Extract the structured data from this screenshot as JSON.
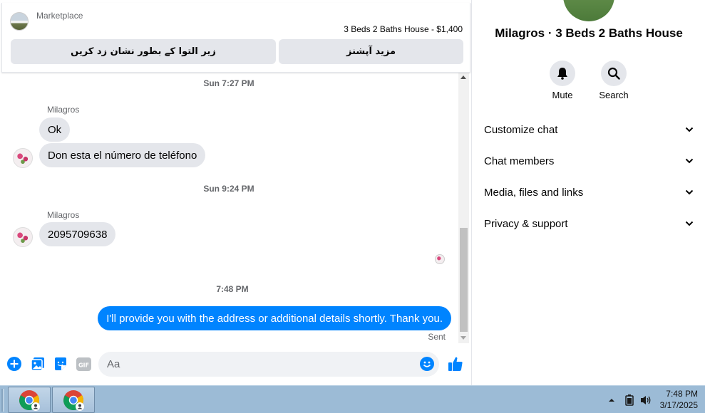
{
  "marketplace": {
    "label": "Marketplace",
    "listing_title": "3 Beds 2 Baths House - $1,400",
    "mark_unavailable_button": "زیر التوا کے بطور نشان زد کریں",
    "more_options_button": "مزید آپشنز"
  },
  "messages": [
    {
      "type": "timestamp",
      "text": "Sun 7:27 PM"
    },
    {
      "type": "sender",
      "text": "Milagros"
    },
    {
      "type": "incoming",
      "text": "Ok"
    },
    {
      "type": "incoming",
      "text": "Don esta el número de teléfono"
    },
    {
      "type": "timestamp",
      "text": "Sun 9:24 PM"
    },
    {
      "type": "sender",
      "text": "Milagros"
    },
    {
      "type": "incoming",
      "text": "2095709638"
    },
    {
      "type": "timestamp",
      "text": "7:48 PM"
    },
    {
      "type": "outgoing",
      "text": "I'll provide you with the address or additional details shortly. Thank you."
    },
    {
      "type": "status",
      "text": "Sent"
    }
  ],
  "composer": {
    "placeholder": "Aa",
    "icons": [
      "plus-circle-icon",
      "gallery-icon",
      "sticker-icon",
      "gif-icon",
      "emoji-icon",
      "thumbs-up-icon"
    ],
    "gif_label": "GIF"
  },
  "info_panel": {
    "name": "Milagros · 3 Beds 2 Baths House",
    "actions": [
      {
        "label": "Mute",
        "icon": "bell-icon"
      },
      {
        "label": "Search",
        "icon": "search-icon"
      }
    ],
    "sections": [
      {
        "label": "Customize chat"
      },
      {
        "label": "Chat members"
      },
      {
        "label": "Media, files and links"
      },
      {
        "label": "Privacy & support"
      }
    ]
  },
  "taskbar": {
    "apps": [
      "chrome-icon",
      "chrome-icon"
    ],
    "tray_icons": [
      "show-hidden-icons-arrow",
      "battery-icon",
      "volume-icon"
    ],
    "time": "7:48 PM",
    "date": "3/17/2025"
  },
  "colors": {
    "accent": "#0084ff",
    "bubble_in": "#e4e6eb",
    "taskbar": "#9cbbd6"
  }
}
